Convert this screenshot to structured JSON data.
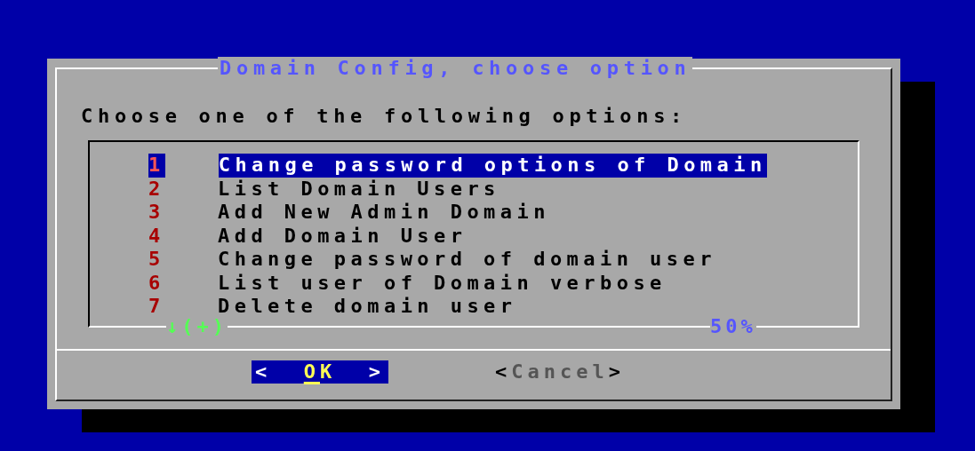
{
  "dialog": {
    "title": "Domain Config, choose option",
    "prompt": "Choose one of the following options:",
    "menu": {
      "items": [
        {
          "tag": "1",
          "label": "Change password options of Domain",
          "selected": true
        },
        {
          "tag": "2",
          "label": "List Domain Users",
          "selected": false
        },
        {
          "tag": "3",
          "label": "Add New Admin Domain",
          "selected": false
        },
        {
          "tag": "4",
          "label": "Add Domain User",
          "selected": false
        },
        {
          "tag": "5",
          "label": "Change password of domain user",
          "selected": false
        },
        {
          "tag": "6",
          "label": "List user of Domain verbose",
          "selected": false
        },
        {
          "tag": "7",
          "label": "Delete domain user",
          "selected": false
        }
      ],
      "more_indicator": "↓(+)",
      "scroll_percent": "50%"
    },
    "buttons": [
      {
        "open": "<",
        "label": "OK",
        "close": ">",
        "selected": true
      },
      {
        "open": "<",
        "label": "Cancel",
        "close": ">",
        "selected": false
      }
    ]
  }
}
